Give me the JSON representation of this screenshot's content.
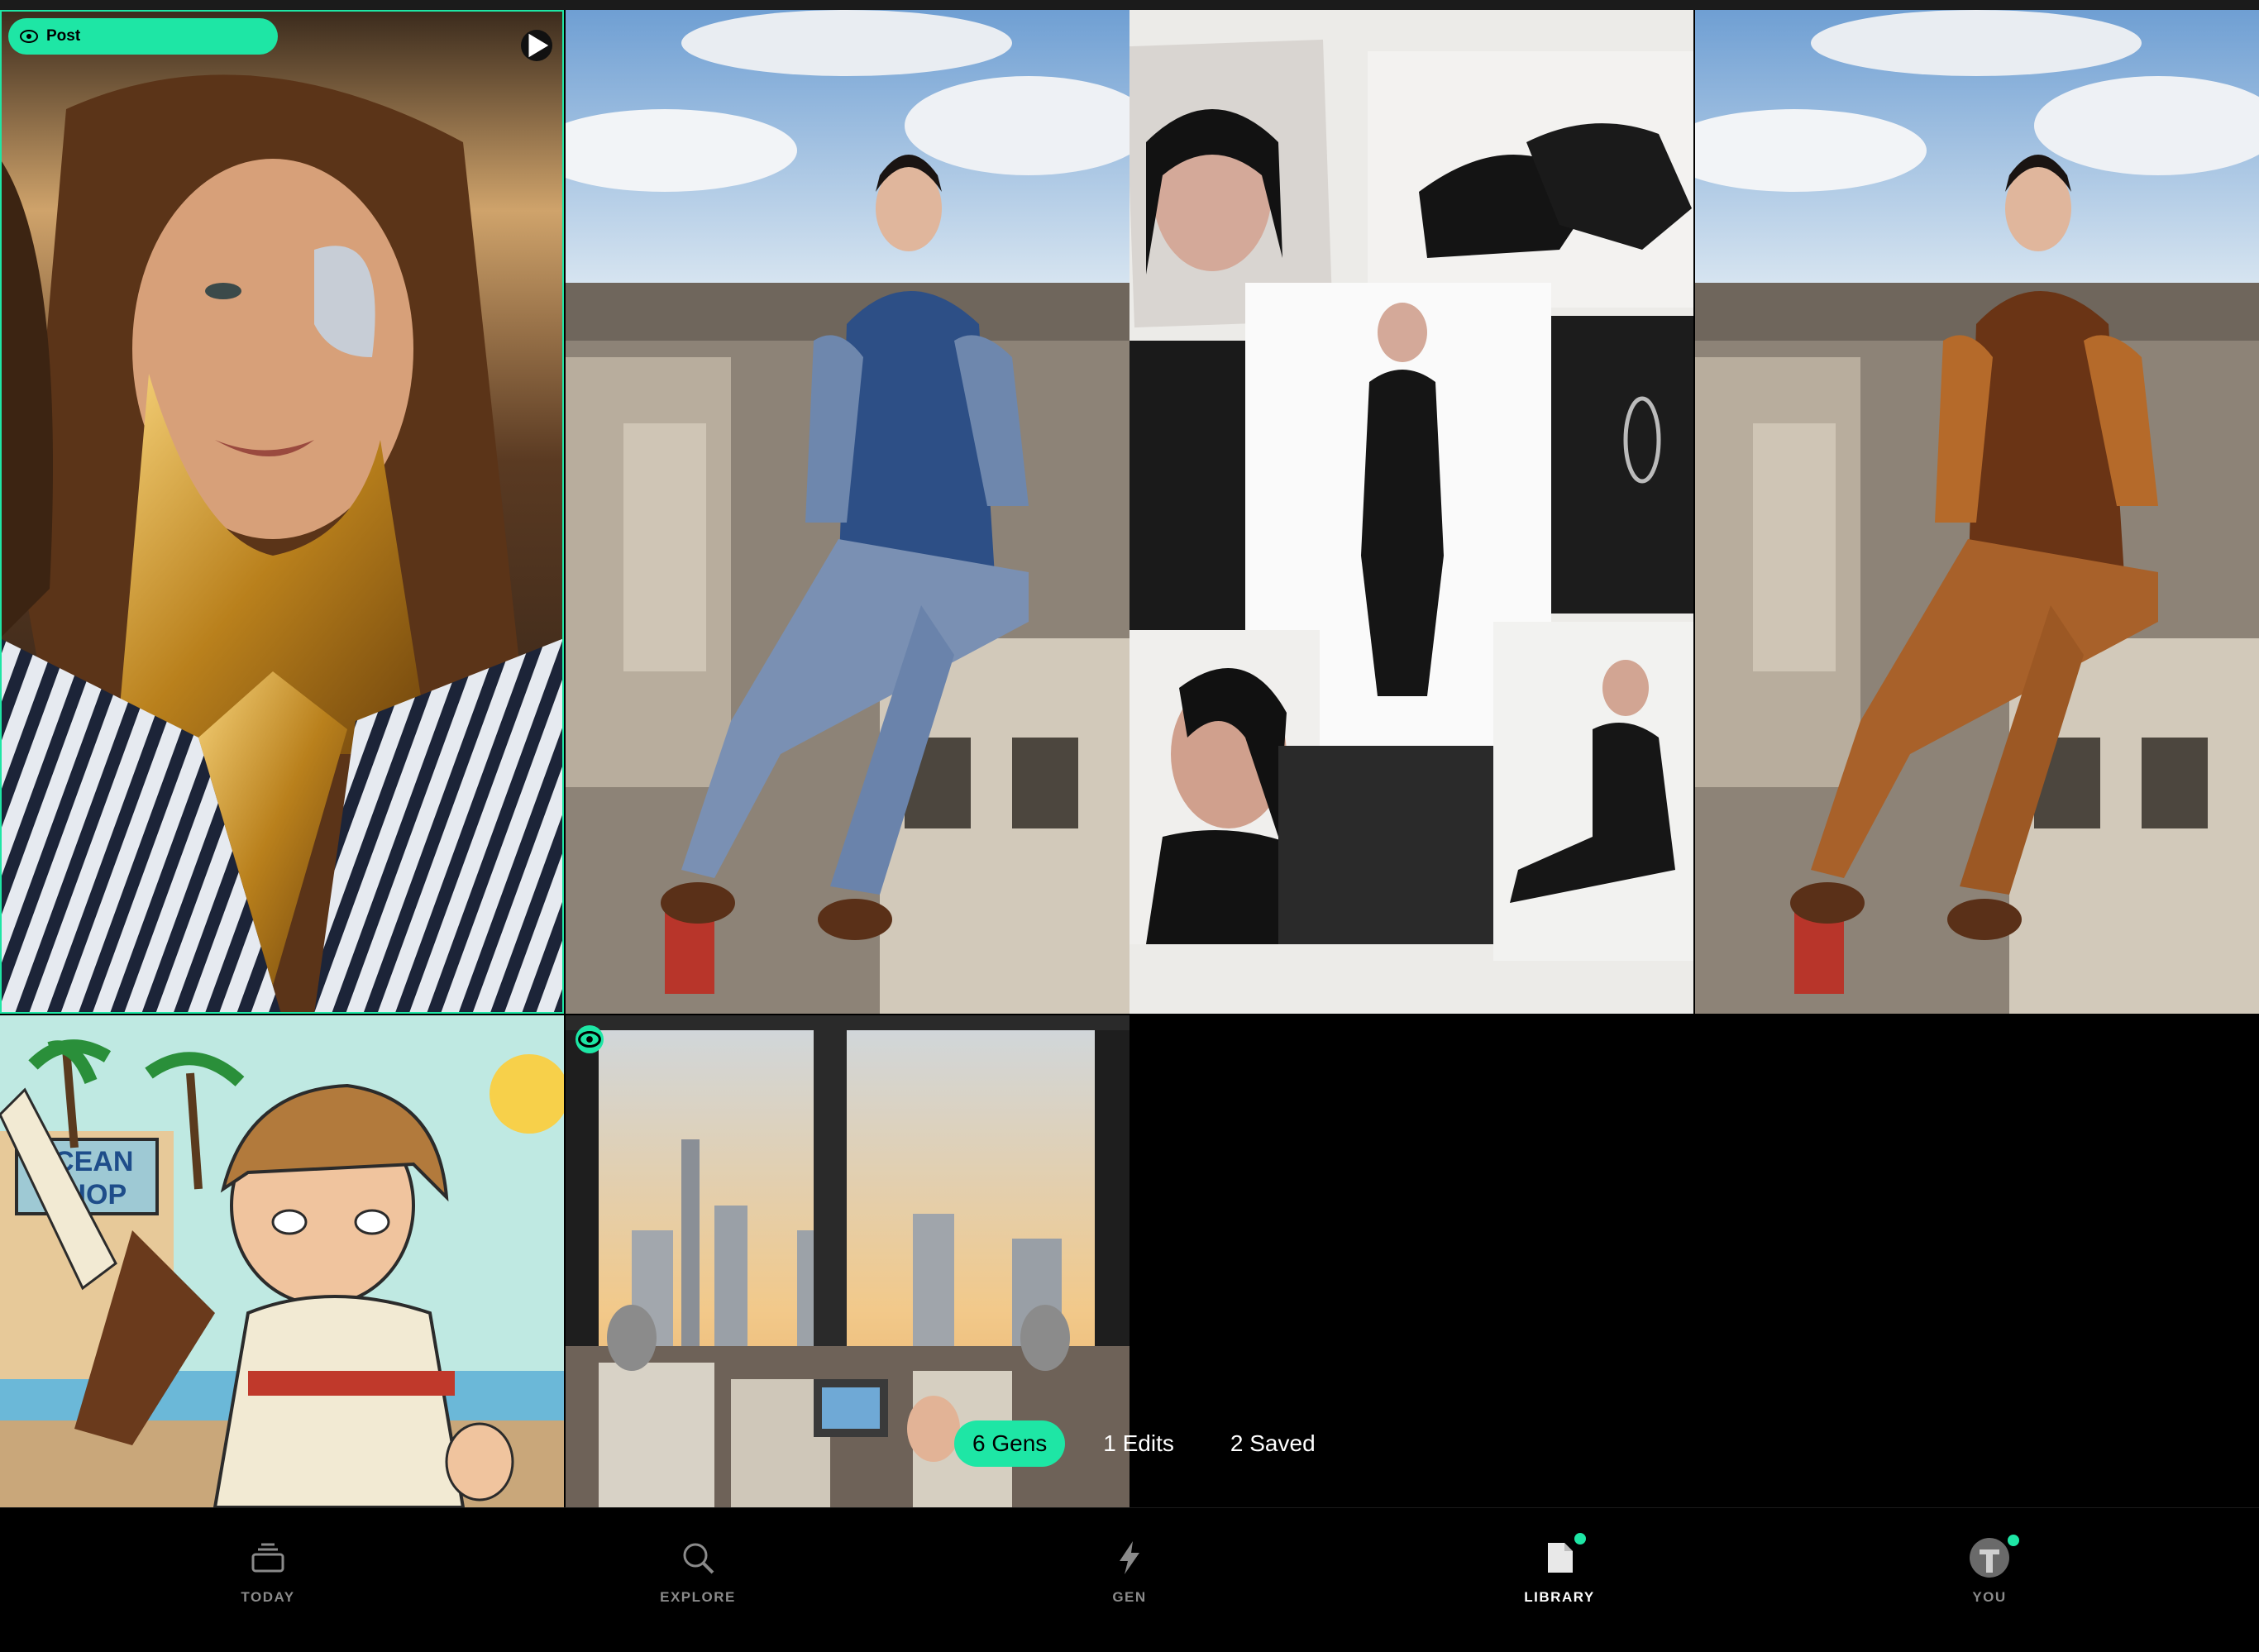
{
  "post_label": "Post",
  "filters": [
    {
      "label": "6 Gens",
      "active": true
    },
    {
      "label": "1 Edits",
      "active": false
    },
    {
      "label": "2 Saved",
      "active": false
    }
  ],
  "tabs": {
    "today": "TODAY",
    "explore": "EXPLORE",
    "gen": "GEN",
    "library": "LIBRARY",
    "you": "YOU"
  },
  "comic_sign": {
    "line1": "OCEAN",
    "line2": "SHOP"
  },
  "colors": {
    "accent": "#1ee6a5",
    "background": "#000000",
    "inactive": "#8a8a8a"
  }
}
